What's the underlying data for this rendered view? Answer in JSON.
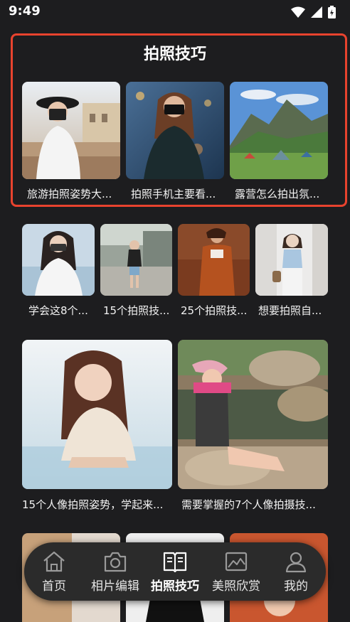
{
  "status": {
    "time": "9:49"
  },
  "tips_section": {
    "title": "拍照技巧",
    "cards": [
      {
        "caption": "旅游拍照姿势大..."
      },
      {
        "caption": "拍照手机主要看..."
      },
      {
        "caption": "露营怎么拍出氛..."
      }
    ]
  },
  "grid_small": [
    {
      "caption": "学会这8个..."
    },
    {
      "caption": "15个拍照技..."
    },
    {
      "caption": "25个拍照技..."
    },
    {
      "caption": "想要拍照自..."
    }
  ],
  "grid_large": [
    {
      "caption": "15个人像拍照姿势，学起来..."
    },
    {
      "caption": "需要掌握的7个人像拍摄技..."
    }
  ],
  "nav": {
    "items": [
      {
        "label": "首页",
        "icon": "home-icon"
      },
      {
        "label": "相片编辑",
        "icon": "camera-edit-icon"
      },
      {
        "label": "拍照技巧",
        "icon": "book-icon",
        "active": true
      },
      {
        "label": "美照欣赏",
        "icon": "picture-icon"
      },
      {
        "label": "我的",
        "icon": "user-icon"
      }
    ]
  }
}
